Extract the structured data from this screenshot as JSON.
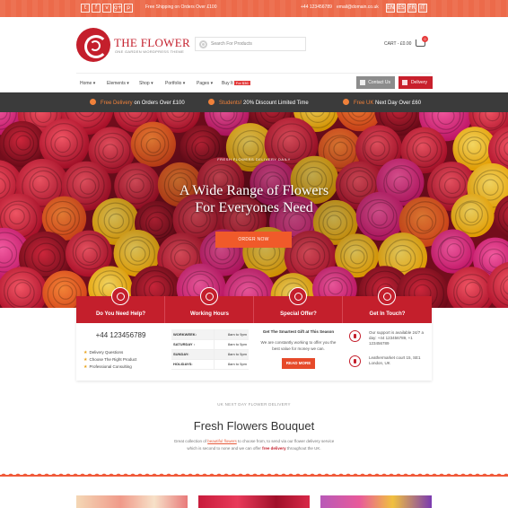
{
  "topbar": {
    "social": [
      "t",
      "f",
      "v",
      "g+",
      "p"
    ],
    "message": "Free Shipping on Orders Over £100",
    "phone": "+44 123456789",
    "email": "email@domain.co.uk",
    "languages": [
      "EN",
      "ES",
      "FR",
      "IT"
    ]
  },
  "header": {
    "logo_title": "THE FLOWER",
    "logo_subtitle": "ONE GARDEN WORDPRESS THEME",
    "search_placeholder": "Search For Products",
    "cart_label": "CART - £0.00",
    "cart_count": "0"
  },
  "nav": {
    "items": [
      "Home",
      "Elements",
      "Shop",
      "Portfolio",
      "Pages",
      "Buy It"
    ],
    "buy_badge": "For $36",
    "contact_label": "Contact Us",
    "delivery_label": "Delivery"
  },
  "promo": [
    {
      "highlight": "Free Delivery",
      "text": " on Orders Over £100"
    },
    {
      "highlight": "Students!",
      "text": " 20% Discount Limited Time"
    },
    {
      "highlight": "Free UK",
      "text": " Next Day Over £60"
    }
  ],
  "hero": {
    "kicker": "FRESH FLOWERS DELIVERY DAILY",
    "title_line1": "A Wide Range of Flowers",
    "title_line2": "For Everyones Need",
    "button": "ORDER NOW"
  },
  "cards": {
    "help": {
      "title": "Do You Need Help?",
      "phone": "+44 123456789",
      "items": [
        "Delivery Questions",
        "Choose The Right Product",
        "Professional Consulting"
      ]
    },
    "hours": {
      "title": "Working Hours",
      "rows": [
        {
          "day": "WORKWEEK:",
          "time": "8am to 9pm"
        },
        {
          "day": "SATURDAY :",
          "time": "8am to 5pm"
        },
        {
          "day": "SUNDAY:",
          "time": "8am to 5pm"
        },
        {
          "day": "HOLIDAYS:",
          "time": "8am to 5pm"
        }
      ]
    },
    "offer": {
      "title": "Special Offer?",
      "subtitle": "Get The Smartest Gift at This Season",
      "text": "We are constantly working to offer you the best value for money we can.",
      "button": "READ MORE"
    },
    "touch": {
      "title": "Get In Touch?",
      "support": "Our support is available 24/7 a day: +44 123456789, +1 123456789",
      "address": "Leathermarket court 15, SE1 London, UK"
    }
  },
  "bouquet": {
    "kicker": "UK NEXT DAY FLOWER DELIVERY",
    "title": "Fresh Flowers Bouquet",
    "text_a": "Great collection of ",
    "text_link": "beautiful flowers",
    "text_b": " to choose from, to send via our flower delivery service which is second to none and we can offer ",
    "text_red": "free delivery",
    "text_c": " throughout the UK."
  },
  "colors": {
    "accent": "#c41f2c",
    "orange": "#ec6a4a",
    "dark_bar": "#3b3b3b"
  }
}
